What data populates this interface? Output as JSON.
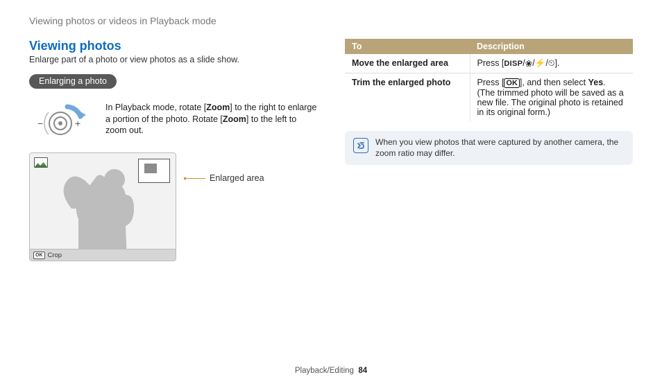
{
  "breadcrumb": "Viewing photos or videos in Playback mode",
  "heading": "Viewing photos",
  "intro": "Enlarge part of a photo or view photos as a slide show.",
  "pill": "Enlarging a photo",
  "zoom_instruction": {
    "pre1": "In Playback mode, rotate [",
    "zoom1": "Zoom",
    "mid1": "] to the right to enlarge a portion of the photo. Rotate [",
    "zoom2": "Zoom",
    "post1": "] to the left to zoom out."
  },
  "dial": {
    "minus": "−",
    "plus": "+"
  },
  "lcd": {
    "crop_label": "Crop",
    "ok_mini": "OK"
  },
  "enlarged_area_label": "Enlarged area",
  "table": {
    "headers": {
      "to": "To",
      "desc": "Description"
    },
    "rows": [
      {
        "to": "Move the enlarged area",
        "desc": {
          "press_open": "Press [",
          "disp": "DISP",
          "sep1": "/",
          "flower": "❀",
          "sep2": "/",
          "flash": "⚡",
          "sep3": "/",
          "timer": "⏲",
          "close": "]."
        }
      },
      {
        "to": "Trim the enlarged photo",
        "desc": {
          "press_open": "Press [",
          "ok": "OK",
          "after_ok": "], and then select ",
          "yes": "Yes",
          "period": ".",
          "paren": "(The trimmed photo will be saved as a new file. The original photo is retained in its original form.)"
        }
      }
    ]
  },
  "note": {
    "icon_name": "note-icon",
    "text": "When you view photos that were captured by another camera, the zoom ratio may differ."
  },
  "footer": {
    "section": "Playback/Editing",
    "page": "84"
  }
}
